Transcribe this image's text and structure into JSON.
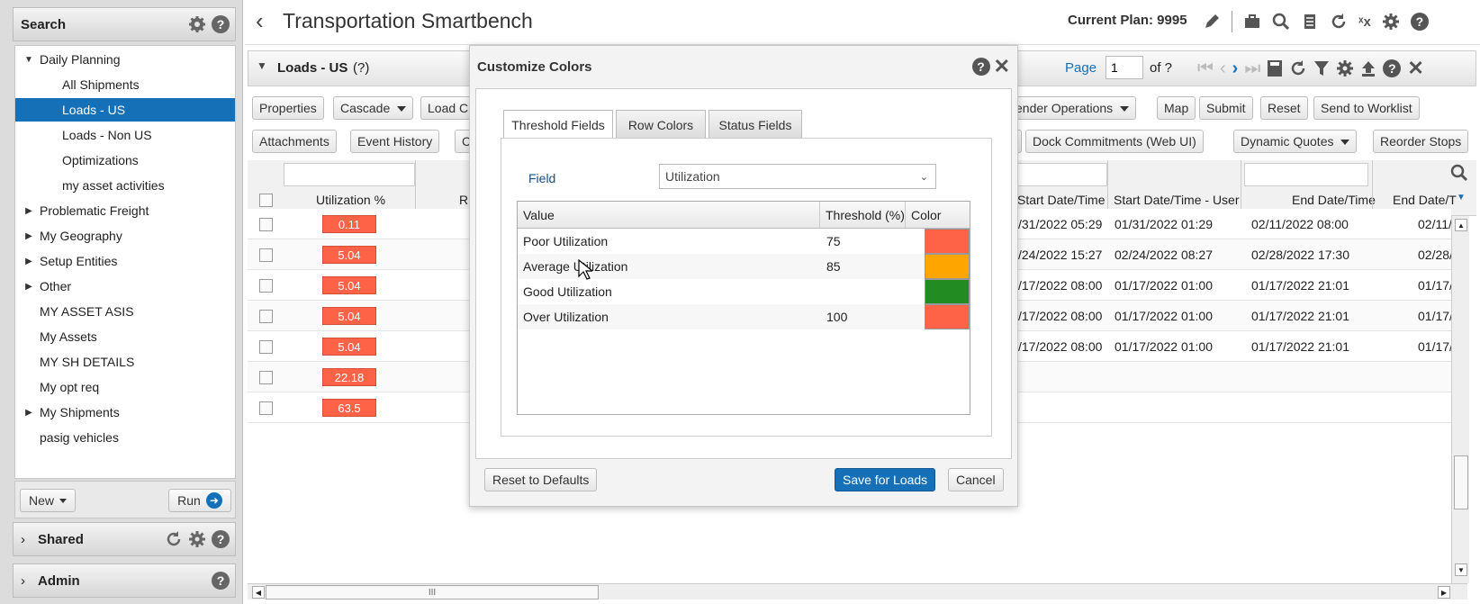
{
  "left": {
    "search_title": "Search",
    "tree": [
      {
        "label": "Daily Planning",
        "arrow": "down",
        "indent": 0
      },
      {
        "label": "All Shipments",
        "arrow": "none",
        "indent": 1
      },
      {
        "label": "Loads - US",
        "arrow": "none",
        "indent": 1,
        "selected": true
      },
      {
        "label": "Loads - Non US",
        "arrow": "none",
        "indent": 1
      },
      {
        "label": "Optimizations",
        "arrow": "none",
        "indent": 1
      },
      {
        "label": "my asset activities",
        "arrow": "none",
        "indent": 1
      },
      {
        "label": "Problematic Freight",
        "arrow": "right",
        "indent": 0
      },
      {
        "label": "My Geography",
        "arrow": "right",
        "indent": 0
      },
      {
        "label": "Setup Entities",
        "arrow": "right",
        "indent": 0
      },
      {
        "label": "Other",
        "arrow": "right",
        "indent": 0
      },
      {
        "label": "MY ASSET ASIS",
        "arrow": "none",
        "indent": 0
      },
      {
        "label": "My Assets",
        "arrow": "none",
        "indent": 0
      },
      {
        "label": "MY SH DETAILS",
        "arrow": "none",
        "indent": 0
      },
      {
        "label": "My opt req",
        "arrow": "none",
        "indent": 0
      },
      {
        "label": "My Shipments",
        "arrow": "right",
        "indent": 0
      },
      {
        "label": "pasig vehicles",
        "arrow": "none",
        "indent": 0
      }
    ],
    "new_label": "New",
    "run_label": "Run",
    "shared_title": "Shared",
    "admin_title": "Admin"
  },
  "header": {
    "back_glyph": "‹",
    "title": "Transportation Smartbench",
    "current_plan": "Current Plan: 9995"
  },
  "loads": {
    "title": "Loads - US",
    "count": "(?)",
    "page_label": "Page",
    "page_value": "1",
    "of_label": "of ?",
    "toolbar1": {
      "properties": "Properties",
      "cascade": "Cascade",
      "load_c": "Load C",
      "tender_ops": "ender Operations",
      "map": "Map",
      "submit": "Submit",
      "reset": "Reset",
      "send_worklist": "Send to Worklist"
    },
    "toolbar2": {
      "attachments": "Attachments",
      "event_history": "Event History",
      "c": "C",
      "dock_commitments": "Dock Commitments (Web UI)",
      "dynamic_quotes": "Dynamic Quotes",
      "reorder_stops": "Reorder Stops"
    }
  },
  "grid": {
    "columns": {
      "utilization": "Utilization %",
      "r": "R",
      "start": "Start Date/Time",
      "start_user": "Start Date/Time - User",
      "end": "End Date/Time",
      "end_user": "End Date/T"
    },
    "rows": [
      {
        "util": "0.11",
        "start": "/31/2022 05:29",
        "start_user": "01/31/2022 01:29",
        "end": "02/11/2022 08:00",
        "end_user": "02/11/"
      },
      {
        "util": "5.04",
        "start": "/24/2022 15:27",
        "start_user": "02/24/2022 08:27",
        "end": "02/28/2022 17:30",
        "end_user": "02/28/"
      },
      {
        "util": "5.04",
        "start": "/17/2022 08:00",
        "start_user": "01/17/2022 01:00",
        "end": "01/17/2022 21:01",
        "end_user": "01/17/2"
      },
      {
        "util": "5.04",
        "start": "/17/2022 08:00",
        "start_user": "01/17/2022 01:00",
        "end": "01/17/2022 21:01",
        "end_user": "01/17/2"
      },
      {
        "util": "5.04",
        "start": "/17/2022 08:00",
        "start_user": "01/17/2022 01:00",
        "end": "01/17/2022 21:01",
        "end_user": "01/17/2"
      },
      {
        "util": "22.18",
        "start": "",
        "start_user": "",
        "end": "",
        "end_user": ""
      },
      {
        "util": "63.5",
        "start": "",
        "start_user": "",
        "end": "",
        "end_user": ""
      }
    ],
    "hscroll_grip": "III"
  },
  "modal": {
    "title": "Customize Colors",
    "tabs": [
      "Threshold Fields",
      "Row Colors",
      "Status Fields"
    ],
    "field_label": "Field",
    "field_value": "Utilization",
    "table_headers": {
      "value": "Value",
      "threshold": "Threshold (%)",
      "color": "Color"
    },
    "rows": [
      {
        "value": "Poor Utilization",
        "threshold": "75",
        "color": "#ff6347"
      },
      {
        "value": "Average Utilization",
        "threshold": "85",
        "color": "#ffa500"
      },
      {
        "value": "Good Utilization",
        "threshold": "",
        "color": "#228b22"
      },
      {
        "value": "Over Utilization",
        "threshold": "100",
        "color": "#ff6347"
      }
    ],
    "reset_label": "Reset to Defaults",
    "save_label": "Save for Loads",
    "cancel_label": "Cancel"
  },
  "colors": {
    "accent": "#1570b8",
    "tomato": "#ff6347",
    "orange": "#ffa500",
    "green": "#228b22"
  }
}
